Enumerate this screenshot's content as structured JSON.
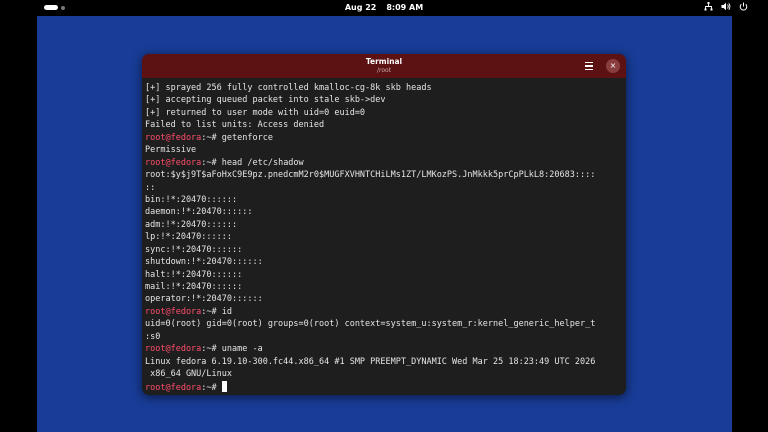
{
  "topbar": {
    "date": "Aug 22",
    "time": "8:09 AM",
    "icons": [
      "network-icon",
      "volume-icon",
      "power-icon"
    ]
  },
  "window": {
    "title": "Terminal",
    "subtitle": "/root",
    "header_color": "#5c1212",
    "menu_icon": "hamburger-menu-icon",
    "close_icon": "close-icon",
    "close_glyph": "×"
  },
  "colors": {
    "desktop": "#183c97",
    "terminal_bg": "#1e1e1e",
    "prompt": "#ff4d6a",
    "text": "#e5e5e5"
  },
  "terminal": {
    "prompt": "root@fedora",
    "prompt_suffix": ":~# ",
    "lines": [
      {
        "type": "out",
        "text": "[+] sprayed 256 fully controlled kmalloc-cg-8k skb heads"
      },
      {
        "type": "out",
        "text": "[+] accepting queued packet into stale skb->dev"
      },
      {
        "type": "out",
        "text": "[+] returned to user mode with uid=0 euid=0"
      },
      {
        "type": "out",
        "text": "Failed to list units: Access denied"
      },
      {
        "type": "cmd",
        "text": "getenforce"
      },
      {
        "type": "out",
        "text": "Permissive"
      },
      {
        "type": "cmd",
        "text": "head /etc/shadow"
      },
      {
        "type": "out",
        "text": "root:$y$j9T$aFoHxC9E9pz.pnedcmM2r0$MUGFXVHNTCHiLMs1ZT/LMKozPS.JnMkkk5prCpPLkL8:20683::::"
      },
      {
        "type": "out",
        "text": "::"
      },
      {
        "type": "out",
        "text": "bin:!*:20470::::::"
      },
      {
        "type": "out",
        "text": "daemon:!*:20470::::::"
      },
      {
        "type": "out",
        "text": "adm:!*:20470::::::"
      },
      {
        "type": "out",
        "text": "lp:!*:20470::::::"
      },
      {
        "type": "out",
        "text": "sync:!*:20470::::::"
      },
      {
        "type": "out",
        "text": "shutdown:!*:20470::::::"
      },
      {
        "type": "out",
        "text": "halt:!*:20470::::::"
      },
      {
        "type": "out",
        "text": "mail:!*:20470::::::"
      },
      {
        "type": "out",
        "text": "operator:!*:20470::::::"
      },
      {
        "type": "cmd",
        "text": "id"
      },
      {
        "type": "out",
        "text": "uid=0(root) gid=0(root) groups=0(root) context=system_u:system_r:kernel_generic_helper_t"
      },
      {
        "type": "out",
        "text": ":s0"
      },
      {
        "type": "cmd",
        "text": "uname -a"
      },
      {
        "type": "out",
        "text": "Linux fedora 6.19.10-300.fc44.x86_64 #1 SMP PREEMPT_DYNAMIC Wed Mar 25 18:23:49 UTC 2026"
      },
      {
        "type": "out",
        "text": " x86_64 GNU/Linux"
      },
      {
        "type": "cmd",
        "text": "",
        "cursor": true
      }
    ]
  }
}
